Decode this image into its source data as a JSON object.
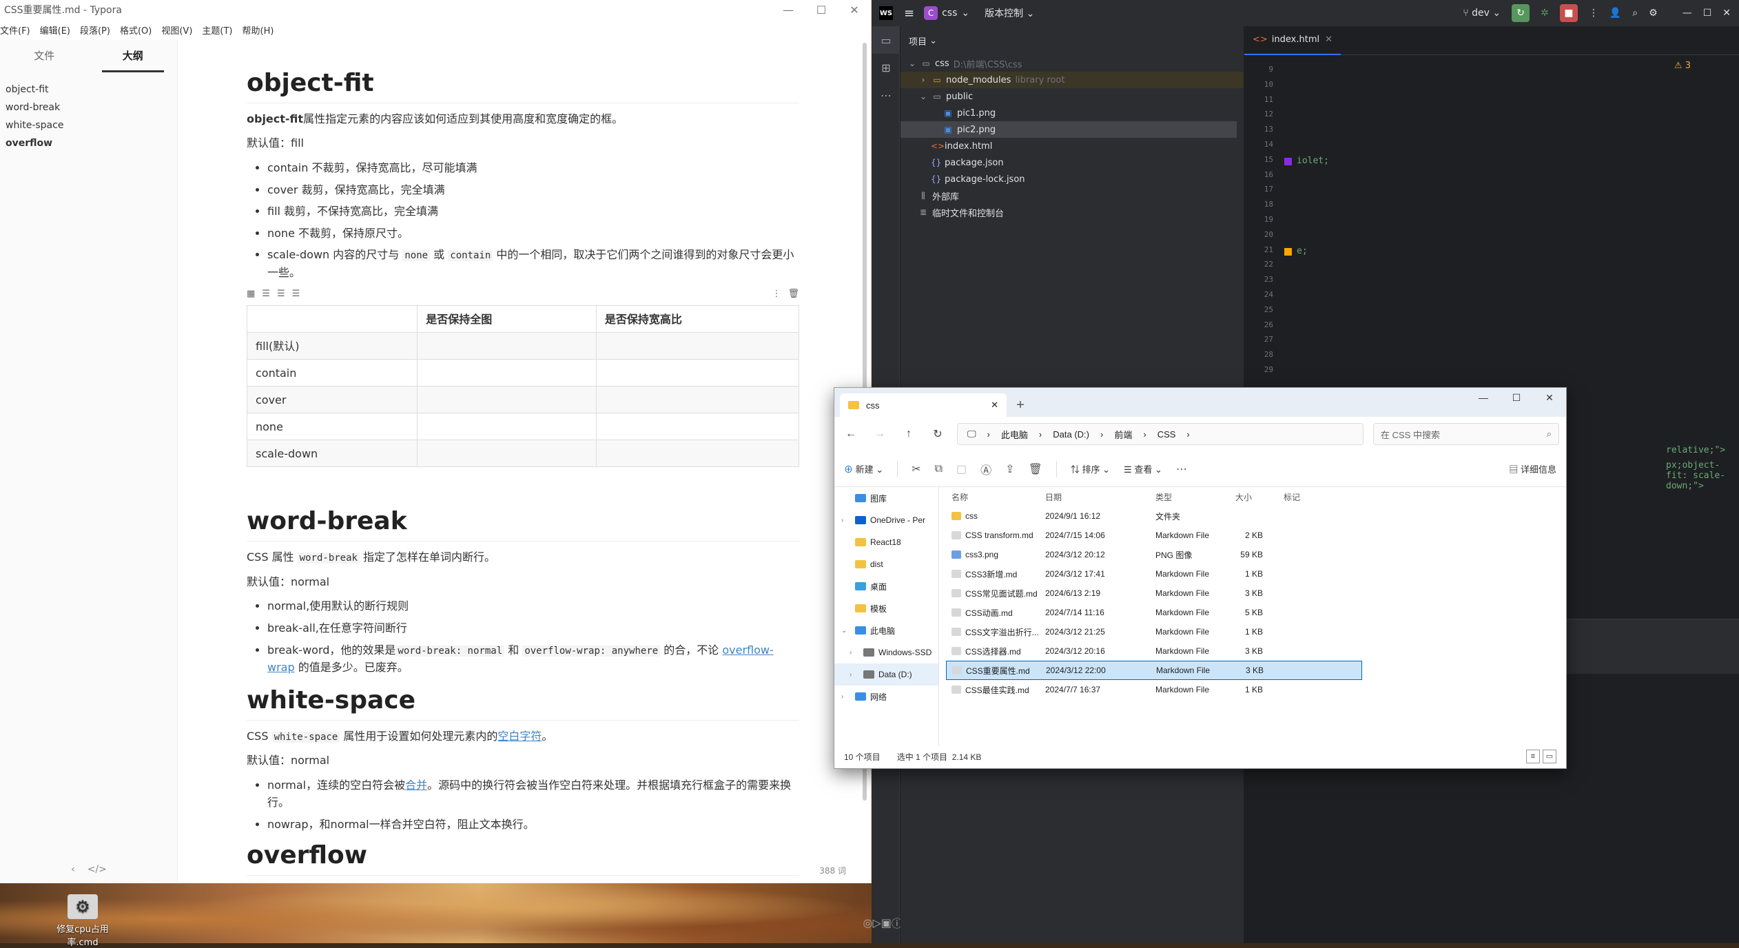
{
  "typora": {
    "title": "CSS重要属性.md - Typora",
    "menu": [
      "文件(F)",
      "编辑(E)",
      "段落(P)",
      "格式(O)",
      "视图(V)",
      "主题(T)",
      "帮助(H)"
    ],
    "tabs": [
      "文件",
      "大纲"
    ],
    "outline": [
      "object-fit",
      "word-break",
      "white-space",
      "overflow"
    ],
    "word_count": "388 词",
    "doc": {
      "h_object_fit": "object-fit",
      "of_bold": "object-fit",
      "of_desc": "属性指定元素的内容应该如何适应到其使用高度和宽度确定的框。",
      "of_default": "默认值：fill",
      "of_li1": "contain 不裁剪，保持宽高比，尽可能填满",
      "of_li2": "cover 裁剪，保持宽高比，完全填满",
      "of_li3": "fill 裁剪，不保持宽高比，完全填满",
      "of_li4": "none 不裁剪，保持原尺寸。",
      "of_li5_a": "scale-down 内容的尺寸与 ",
      "of_li5_code1": "none",
      "of_li5_b": " 或 ",
      "of_li5_code2": "contain",
      "of_li5_c": " 中的一个相同，取决于它们两个之间谁得到的对象尺寸会更小一些。",
      "table_head": [
        "",
        "是否保持全图",
        "是否保持宽高比"
      ],
      "table_rows": [
        "fill(默认)",
        "contain",
        "cover",
        "none",
        "scale-down"
      ],
      "h_word_break": "word-break",
      "wb_a": "CSS 属性 ",
      "wb_code": "word-break",
      "wb_b": " 指定了怎样在单词内断行。",
      "wb_default": "默认值：normal",
      "wb_li1": "normal,使用默认的断行规则",
      "wb_li2": "break-all,在任意字符间断行",
      "wb_li3_a": "break-word，他的效果是",
      "wb_li3_code1": "word-break: normal",
      "wb_li3_b": " 和 ",
      "wb_li3_code2": "overflow-wrap: anywhere",
      "wb_li3_c": " 的合，不论 ",
      "wb_li3_link": "overflow-wrap",
      "wb_li3_d": " 的值是多少。已废弃。",
      "h_white_space": "white-space",
      "ws_a": "CSS ",
      "ws_code": "white-space",
      "ws_b": " 属性用于设置如何处理元素内的",
      "ws_link": "空白字符",
      "ws_c": "。",
      "ws_default": "默认值：normal",
      "ws_li1_a": "normal，连续的空白符会被",
      "ws_li1_link": "合并",
      "ws_li1_b": "。源码中的换行符会被当作空白符来处理。并根据填充行框盒子的需要来换行。",
      "ws_li2": "nowrap，和normal一样合并空白符，阻止文本换行。",
      "h_overflow": "overflow"
    }
  },
  "desktop": {
    "icon_label": "修复cpu占用率.cmd"
  },
  "ide": {
    "project": "css",
    "vcs": "版本控制",
    "branch": "dev",
    "panel_title": "项目",
    "tree": {
      "root": "css",
      "root_path": "D:\\前端\\CSS\\css",
      "node_modules": "node_modules",
      "node_modules_hint": "library root",
      "public": "public",
      "pic1": "pic1.png",
      "pic2": "pic2.png",
      "index": "index.html",
      "package": "package.json",
      "package_lock": "package-lock.json",
      "external": "外部库",
      "scratches": "临时文件和控制台"
    },
    "tab": "index.html",
    "warnings": "3",
    "line_numbers": [
      "9",
      "10",
      "11",
      "12",
      "13",
      "14",
      "15",
      "16",
      "17",
      "18",
      "19",
      "20",
      "21",
      "22",
      "23",
      "24",
      "25",
      "26",
      "27",
      "28",
      "29"
    ],
    "code_frag1": "iolet;",
    "code_frag2": "e;",
    "code_frag3": "relative;\">",
    "code_frag4": "px;object-fit: scale-down;\">",
    "swatch_colors": [
      "#8a2be2",
      "#ffa500"
    ]
  },
  "explorer": {
    "tab_title": "css",
    "breadcrumb": [
      "此电脑",
      "Data (D:)",
      "前端",
      "CSS"
    ],
    "search_placeholder": "在 CSS 中搜索",
    "toolbar": {
      "new": "新建",
      "sort": "排序",
      "view": "查看",
      "details": "详细信息"
    },
    "nav": [
      {
        "label": "图库",
        "color": "#3a8ee6"
      },
      {
        "label": "OneDrive - Per",
        "color": "#0a64c8"
      },
      {
        "label": "React18",
        "color": "#f3c242"
      },
      {
        "label": "dist",
        "color": "#f3c242"
      },
      {
        "label": "桌面",
        "color": "#3aa0e0"
      },
      {
        "label": "模板",
        "color": "#f3c242"
      },
      {
        "label": "此电脑",
        "color": "#3a8ee6"
      },
      {
        "label": "Windows-SSD",
        "color": "#777777"
      },
      {
        "label": "Data (D:)",
        "color": "#777777"
      },
      {
        "label": "网络",
        "color": "#3a8ee6"
      }
    ],
    "columns": [
      "名称",
      "日期",
      "类型",
      "大小",
      "标记"
    ],
    "files": [
      {
        "name": "css",
        "date": "2024/9/1 16:12",
        "type": "文件夹",
        "size": ""
      },
      {
        "name": "CSS transform.md",
        "date": "2024/7/15 14:06",
        "type": "Markdown File",
        "size": "2 KB"
      },
      {
        "name": "css3.png",
        "date": "2024/3/12 20:12",
        "type": "PNG 图像",
        "size": "59 KB"
      },
      {
        "name": "CSS3新增.md",
        "date": "2024/3/12 17:41",
        "type": "Markdown File",
        "size": "1 KB"
      },
      {
        "name": "CSS常见面试题.md",
        "date": "2024/6/13 2:19",
        "type": "Markdown File",
        "size": "3 KB"
      },
      {
        "name": "CSS动画.md",
        "date": "2024/7/14 11:16",
        "type": "Markdown File",
        "size": "5 KB"
      },
      {
        "name": "CSS文字溢出折行...",
        "date": "2024/3/12 21:25",
        "type": "Markdown File",
        "size": "1 KB"
      },
      {
        "name": "CSS选择器.md",
        "date": "2024/3/12 20:16",
        "type": "Markdown File",
        "size": "3 KB"
      },
      {
        "name": "CSS重要属性.md",
        "date": "2024/3/12 22:00",
        "type": "Markdown File",
        "size": "3 KB"
      },
      {
        "name": "CSS最佳实践.md",
        "date": "2024/7/7 16:37",
        "type": "Markdown File",
        "size": "1 KB"
      }
    ],
    "status_count": "10 个项目",
    "status_selected": "选中 1 个项目",
    "status_size": "2.14 KB"
  }
}
